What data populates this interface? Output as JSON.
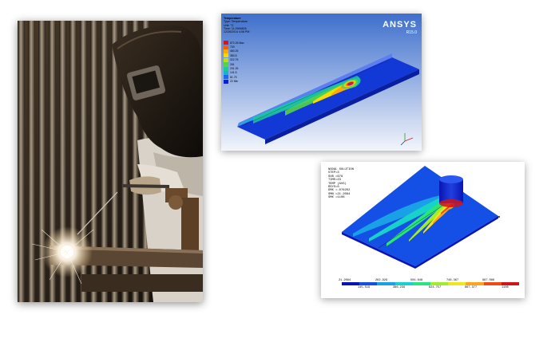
{
  "photo": {
    "subject": "welder-photo"
  },
  "ansys_panel": {
    "brand": "ANSYS",
    "version": "R15.0",
    "info_lines": [
      "Temperature",
      "Type: Temperature",
      "Unit: °C",
      "Time: 11.0994826",
      "12/26/2014 4:08 PM"
    ],
    "legend": [
      {
        "label": "872.26 Max",
        "color": "#e0101a"
      },
      {
        "label": "700",
        "color": "#ff5a00"
      },
      {
        "label": "460.25",
        "color": "#ffa800"
      },
      {
        "label": "380.5",
        "color": "#f5dc00"
      },
      {
        "label": "322.75",
        "color": "#b6e600"
      },
      {
        "label": "261",
        "color": "#55d24a"
      },
      {
        "label": "201.25",
        "color": "#1fc89a"
      },
      {
        "label": "141.5",
        "color": "#13b4d8"
      },
      {
        "label": "81.75",
        "color": "#1a6ae8"
      },
      {
        "label": "22 Min",
        "color": "#0a1fd0"
      }
    ]
  },
  "nodal_panel": {
    "info_lines": [
      "NODAL SOLUTION",
      "STEP=3",
      "SUB =678",
      "TIME=23",
      "TEMP    (AVG)",
      "RSYS=0",
      "DMX =.076202",
      "SMN =21.2094",
      "SMX =1108"
    ],
    "scale_colors": [
      "#0a14b4",
      "#1450e6",
      "#1aa0e6",
      "#16d2c8",
      "#2ae67a",
      "#a0ee2a",
      "#f0e61a",
      "#ffa51a",
      "#f04a14",
      "#d0141a"
    ],
    "scale_top_labels": [
      "21.2094",
      "262.929",
      "504.648",
      "746.367",
      "987.086"
    ],
    "scale_bottom_labels": [
      "145.519",
      "386.239",
      "624.757",
      "867.377",
      "1108"
    ]
  }
}
